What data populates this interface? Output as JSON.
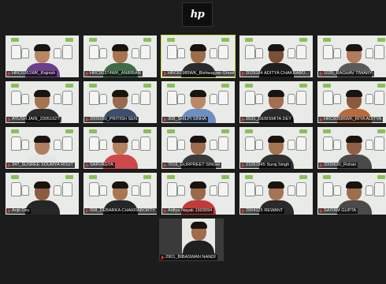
{
  "app": {
    "logo_text": "hp"
  },
  "participants": [
    {
      "name": "HRC0261WK_Rajnish",
      "skin": "#b98564",
      "shirt": "#6b3f8d",
      "hair": true,
      "active": false
    },
    {
      "name": "HRC60374WK_ANIRBAN",
      "skin": "#a8744f",
      "shirt": "#3f6c48",
      "hair": true,
      "active": false
    },
    {
      "name": "HRC61985WK_Bishwajyan Ghosh",
      "skin": "#9c6c4b",
      "shirt": "#2b2b2b",
      "hair": true,
      "active": true
    },
    {
      "name": "2029184 ADITYA CHAKRABO...",
      "skin": "#7c5038",
      "shirt": "#1f1f1f",
      "hair": true,
      "active": false
    },
    {
      "name": "1025_RAGHAV TIWARY",
      "skin": "#b07c5b",
      "shirt": "#5a5a5a",
      "hair": true,
      "active": false
    },
    {
      "name": "AYUSH JAIN_2005162T",
      "skin": "#a77452",
      "shirt": "#2c2c2c",
      "hair": true,
      "active": false
    },
    {
      "name": "2005080_PRITISH SEN",
      "skin": "#9a6a4c",
      "shirt": "#3d4f6e",
      "hair": true,
      "active": false
    },
    {
      "name": "308_SHILPI SINHA",
      "skin": "#b98867",
      "shirt": "#6e8fc4",
      "hair": true,
      "active": false
    },
    {
      "name": "2631_DEBISMITA DEY",
      "skin": "#a36f4e",
      "shirt": "#2a2a2a",
      "hair": true,
      "active": false
    },
    {
      "name": "HRC60586WK_RIYA ADITYA",
      "skin": "#8a5a3e",
      "shirt": "#b86a3c",
      "hair": true,
      "active": false
    },
    {
      "name": "347_SUSREE SOUMYA ROUT",
      "skin": "#b07d5e",
      "shirt": "#e6e6e6",
      "hair": true,
      "active": false
    },
    {
      "name": "SARVAGYA",
      "skin": "#b48060",
      "shirt": "#cc4a4a",
      "hair": true,
      "active": false
    },
    {
      "name": "7016_GURPREET SINGH",
      "skin": "#9c6c4b",
      "shirt": "#3a3a3a",
      "hair": true,
      "active": false
    },
    {
      "name": "21051945 Suraj Singh",
      "skin": "#a5734f",
      "shirt": "#2f2f2f",
      "hair": true,
      "active": false
    },
    {
      "name": "2005630_Rohan",
      "skin": "#8f6045",
      "shirt": "#4a4a4a",
      "hair": true,
      "active": false
    },
    {
      "name": "Arijit Dey",
      "skin": "#8c5c40",
      "shirt": "#262626",
      "hair": true,
      "active": false
    },
    {
      "name": "658_DEBARKA CHAKRABORTY",
      "skin": "#a87650",
      "shirt": "#262626",
      "hair": true,
      "active": false
    },
    {
      "name": "Aditya Nayak 1903094",
      "skin": "#9a6a4a",
      "shirt": "#c23a3a",
      "hair": true,
      "active": false
    },
    {
      "name": "2004125 REWANT",
      "skin": "#a57454",
      "shirt": "#2a2a2a",
      "hair": true,
      "active": false
    },
    {
      "name": "SAIYAM GUPTA",
      "skin": "#9e6e4c",
      "shirt": "#4a4a4a",
      "hair": true,
      "active": false
    }
  ],
  "solo_participant": {
    "name": "2901_BIBASWAN NANDI",
    "skin": "#a06c4c",
    "shirt": "#1f1f1f"
  }
}
